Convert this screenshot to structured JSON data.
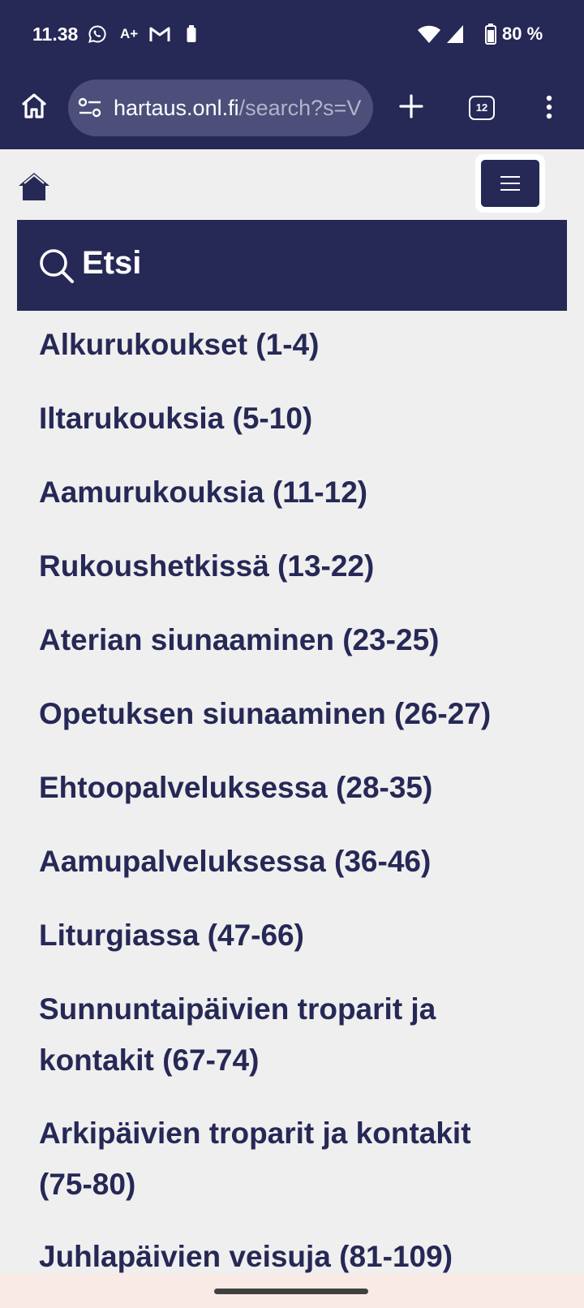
{
  "status_bar": {
    "time": "11.38",
    "battery": "80 %",
    "icons": [
      "whatsapp-icon",
      "font-size-icon",
      "gmail-icon",
      "battery-saver-icon",
      "wifi-icon",
      "cellular-signal-icon",
      "battery-icon"
    ],
    "font_indicator": "A+"
  },
  "browser": {
    "url_host": "hartaus.onl.fi",
    "url_path": "/search?s=V",
    "tab_count": "12",
    "icons": [
      "home-icon",
      "site-settings-icon",
      "new-tab-icon",
      "tab-switcher-icon",
      "more-options-icon"
    ]
  },
  "page": {
    "search_title": "Etsi",
    "categories": [
      "Alkurukoukset (1-4)",
      "Iltarukouksia (5-10)",
      "Aamurukouksia (11-12)",
      "Rukoushetkissä (13-22)",
      "Aterian siunaaminen (23-25)",
      "Opetuksen siunaaminen (26-27)",
      "Ehtoopalveluksessa (28-35)",
      "Aamupalveluksessa (36-46)",
      "Liturgiassa (47-66)",
      "Sunnuntaipäivien troparit ja kontakit (67-74)",
      "Arkipäivien troparit ja kontakit (75-80)",
      "Juhlapäivien veisuja (81-109)"
    ]
  },
  "colors": {
    "brand_navy": "#262856",
    "page_background": "#efefef",
    "nav_bar_background": "#faeae6"
  }
}
